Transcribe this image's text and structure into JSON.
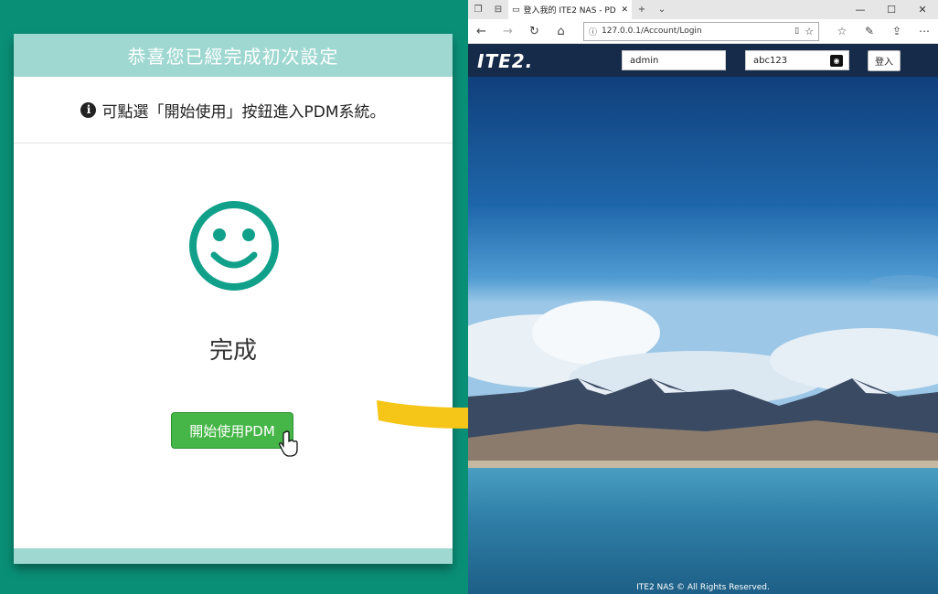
{
  "setup_card": {
    "header": "恭喜您已經完成初次設定",
    "info": "可點選「開始使用」按鈕進入PDM系統。",
    "done": "完成",
    "start_button": "開始使用PDM"
  },
  "browser": {
    "tab_title": "登入我的 ITE2 NAS - PD",
    "address": "127.0.0.1/Account/Login",
    "logo": "ITE2.",
    "username": "admin",
    "password": "abc123",
    "login_button": "登入",
    "footer": "ITE2 NAS © All Rights Reserved."
  },
  "colors": {
    "panel_bg": "#0a8f77",
    "card_header": "#9fd8d1",
    "smiley": "#11a08a",
    "start_button": "#46b648",
    "arrow": "#f5c518",
    "site_header": "#162a4a"
  },
  "icons": [
    "info-icon",
    "smiley-icon",
    "hand-cursor-icon",
    "arrow-icon",
    "eye-icon",
    "back-icon",
    "forward-icon",
    "refresh-icon",
    "home-icon",
    "star-icon"
  ]
}
